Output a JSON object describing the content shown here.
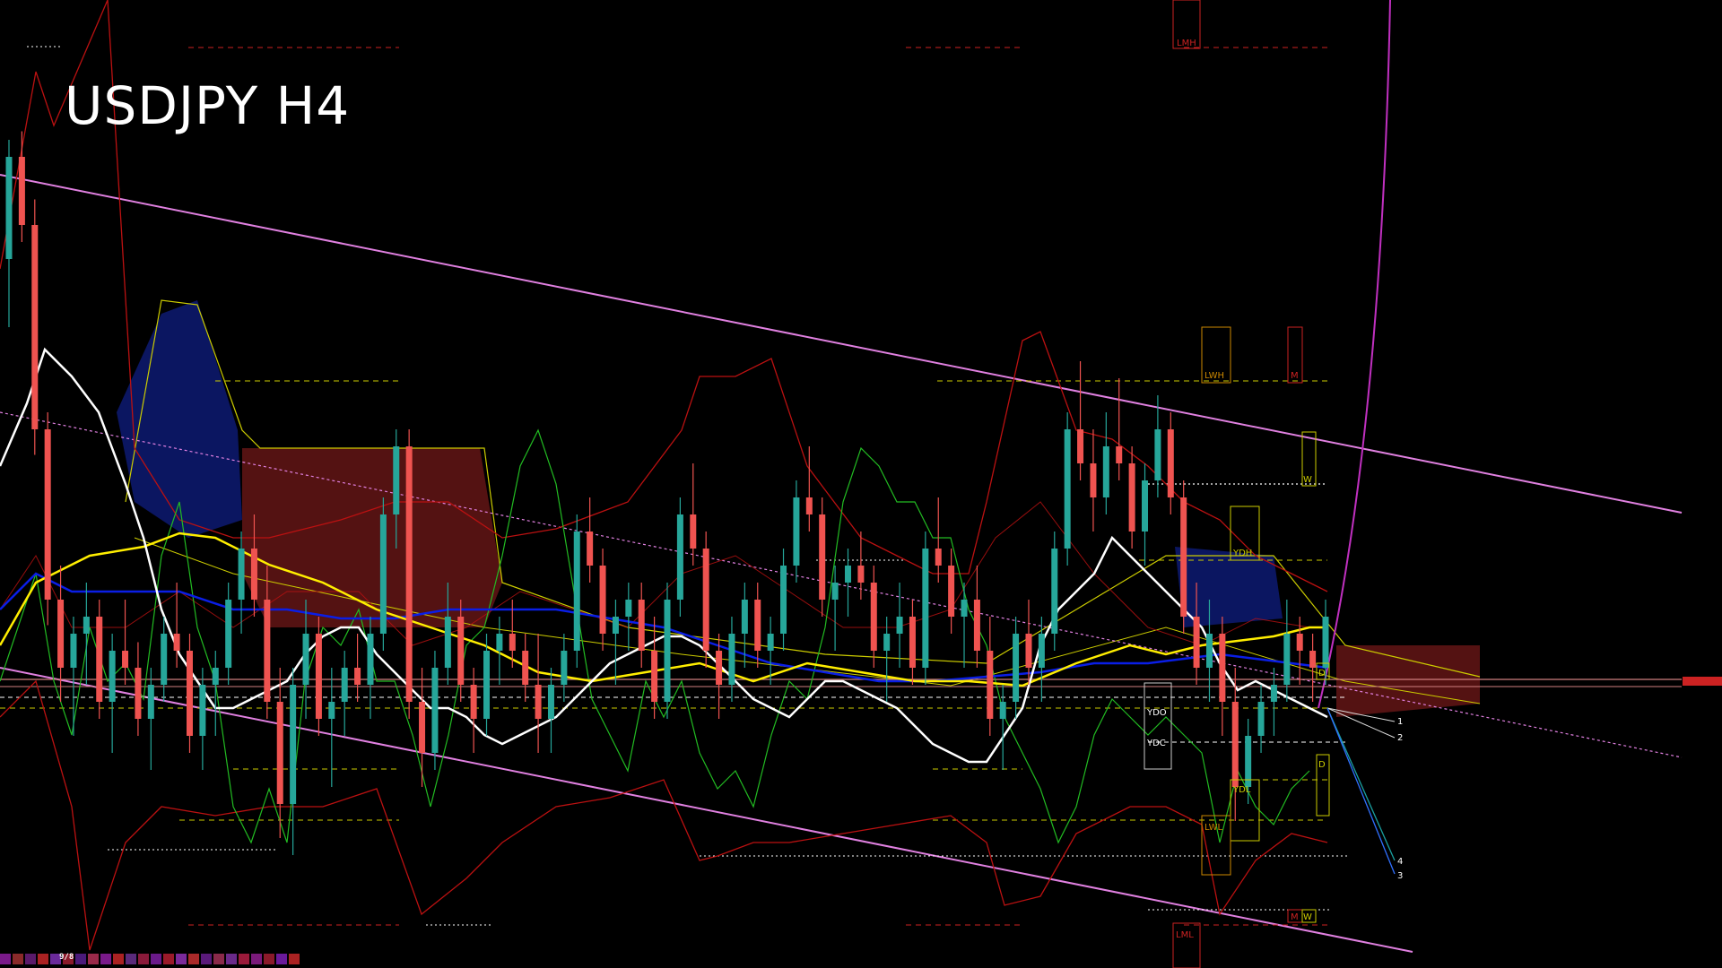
{
  "window": {
    "title": "USDJPY H4",
    "tray_date": "9/8"
  },
  "colors": {
    "background": "#000000",
    "bull_candle": "#26a69a",
    "bear_candle": "#ef5350",
    "ichimoku_bull_cloud": "#1a2a8c",
    "ichimoku_bear_cloud": "#8b1a1a",
    "channel": "#e080e0",
    "ema_white": "#ffffff",
    "ema_yellow": "#ffee00",
    "ema_blue": "#0a1ee6",
    "bollinger": "#cc1111",
    "stoch_green": "#22bb22",
    "level_red": "#cc2222",
    "level_yellow": "#cccc00",
    "level_white": "#ffffff"
  },
  "level_labels": {
    "lmh": "LMH",
    "lml": "LML",
    "lwh": "LWH",
    "lwl": "LWL",
    "m_top": "M",
    "m_bottom": "M",
    "w_top": "W",
    "w_bottom": "W",
    "ydh": "YDH",
    "ydl": "YDL",
    "ydo": "YDO",
    "ydc": "YDC",
    "d_top": "D",
    "d_bottom": "D"
  },
  "projection_labels": [
    "1",
    "2",
    "4",
    "3"
  ],
  "chart_data": {
    "type": "candlestick",
    "title": "USDJPY H4",
    "xlabel": "",
    "ylabel": "",
    "grid": false,
    "candles_ohlc": [
      [
        0.78,
        0.92,
        0.7,
        0.9
      ],
      [
        0.9,
        0.93,
        0.8,
        0.82
      ],
      [
        0.82,
        0.85,
        0.55,
        0.58
      ],
      [
        0.58,
        0.6,
        0.35,
        0.38
      ],
      [
        0.38,
        0.42,
        0.26,
        0.3
      ],
      [
        0.3,
        0.36,
        0.22,
        0.34
      ],
      [
        0.34,
        0.4,
        0.28,
        0.36
      ],
      [
        0.36,
        0.38,
        0.24,
        0.26
      ],
      [
        0.26,
        0.34,
        0.2,
        0.32
      ],
      [
        0.32,
        0.38,
        0.28,
        0.3
      ],
      [
        0.3,
        0.33,
        0.22,
        0.24
      ],
      [
        0.24,
        0.3,
        0.18,
        0.28
      ],
      [
        0.28,
        0.36,
        0.26,
        0.34
      ],
      [
        0.34,
        0.4,
        0.3,
        0.32
      ],
      [
        0.32,
        0.34,
        0.2,
        0.22
      ],
      [
        0.22,
        0.3,
        0.18,
        0.28
      ],
      [
        0.28,
        0.32,
        0.22,
        0.3
      ],
      [
        0.3,
        0.4,
        0.28,
        0.38
      ],
      [
        0.38,
        0.46,
        0.34,
        0.44
      ],
      [
        0.44,
        0.48,
        0.36,
        0.38
      ],
      [
        0.38,
        0.42,
        0.24,
        0.26
      ],
      [
        0.26,
        0.3,
        0.1,
        0.14
      ],
      [
        0.14,
        0.3,
        0.08,
        0.28
      ],
      [
        0.28,
        0.38,
        0.24,
        0.34
      ],
      [
        0.34,
        0.36,
        0.22,
        0.24
      ],
      [
        0.24,
        0.3,
        0.16,
        0.26
      ],
      [
        0.26,
        0.32,
        0.22,
        0.3
      ],
      [
        0.3,
        0.34,
        0.26,
        0.28
      ],
      [
        0.28,
        0.36,
        0.24,
        0.34
      ],
      [
        0.34,
        0.5,
        0.32,
        0.48
      ],
      [
        0.48,
        0.58,
        0.44,
        0.56
      ],
      [
        0.56,
        0.58,
        0.24,
        0.26
      ],
      [
        0.26,
        0.3,
        0.16,
        0.2
      ],
      [
        0.2,
        0.32,
        0.18,
        0.3
      ],
      [
        0.3,
        0.4,
        0.28,
        0.36
      ],
      [
        0.36,
        0.38,
        0.26,
        0.28
      ],
      [
        0.28,
        0.3,
        0.2,
        0.24
      ],
      [
        0.24,
        0.34,
        0.22,
        0.32
      ],
      [
        0.32,
        0.36,
        0.28,
        0.34
      ],
      [
        0.34,
        0.38,
        0.3,
        0.32
      ],
      [
        0.32,
        0.34,
        0.26,
        0.28
      ],
      [
        0.28,
        0.34,
        0.2,
        0.24
      ],
      [
        0.24,
        0.3,
        0.2,
        0.28
      ],
      [
        0.28,
        0.34,
        0.26,
        0.32
      ],
      [
        0.32,
        0.48,
        0.3,
        0.46
      ],
      [
        0.46,
        0.5,
        0.4,
        0.42
      ],
      [
        0.42,
        0.44,
        0.32,
        0.34
      ],
      [
        0.34,
        0.38,
        0.28,
        0.36
      ],
      [
        0.36,
        0.4,
        0.32,
        0.38
      ],
      [
        0.38,
        0.4,
        0.3,
        0.32
      ],
      [
        0.32,
        0.36,
        0.24,
        0.26
      ],
      [
        0.26,
        0.4,
        0.24,
        0.38
      ],
      [
        0.38,
        0.5,
        0.36,
        0.48
      ],
      [
        0.48,
        0.54,
        0.42,
        0.44
      ],
      [
        0.44,
        0.46,
        0.3,
        0.32
      ],
      [
        0.32,
        0.34,
        0.24,
        0.28
      ],
      [
        0.28,
        0.36,
        0.26,
        0.34
      ],
      [
        0.34,
        0.4,
        0.3,
        0.38
      ],
      [
        0.38,
        0.4,
        0.3,
        0.32
      ],
      [
        0.32,
        0.36,
        0.28,
        0.34
      ],
      [
        0.34,
        0.44,
        0.32,
        0.42
      ],
      [
        0.42,
        0.52,
        0.4,
        0.5
      ],
      [
        0.5,
        0.56,
        0.46,
        0.48
      ],
      [
        0.48,
        0.5,
        0.36,
        0.38
      ],
      [
        0.38,
        0.42,
        0.32,
        0.4
      ],
      [
        0.4,
        0.44,
        0.36,
        0.42
      ],
      [
        0.42,
        0.46,
        0.38,
        0.4
      ],
      [
        0.4,
        0.42,
        0.3,
        0.32
      ],
      [
        0.32,
        0.36,
        0.26,
        0.34
      ],
      [
        0.34,
        0.4,
        0.3,
        0.36
      ],
      [
        0.36,
        0.38,
        0.28,
        0.3
      ],
      [
        0.3,
        0.46,
        0.28,
        0.44
      ],
      [
        0.44,
        0.5,
        0.4,
        0.42
      ],
      [
        0.42,
        0.44,
        0.34,
        0.36
      ],
      [
        0.36,
        0.4,
        0.3,
        0.38
      ],
      [
        0.38,
        0.42,
        0.3,
        0.32
      ],
      [
        0.32,
        0.36,
        0.22,
        0.24
      ],
      [
        0.24,
        0.28,
        0.18,
        0.26
      ],
      [
        0.26,
        0.36,
        0.24,
        0.34
      ],
      [
        0.34,
        0.38,
        0.28,
        0.3
      ],
      [
        0.3,
        0.36,
        0.26,
        0.34
      ],
      [
        0.34,
        0.46,
        0.32,
        0.44
      ],
      [
        0.44,
        0.6,
        0.42,
        0.58
      ],
      [
        0.58,
        0.66,
        0.52,
        0.54
      ],
      [
        0.54,
        0.58,
        0.46,
        0.5
      ],
      [
        0.5,
        0.6,
        0.48,
        0.56
      ],
      [
        0.56,
        0.64,
        0.52,
        0.54
      ],
      [
        0.54,
        0.56,
        0.44,
        0.46
      ],
      [
        0.46,
        0.54,
        0.42,
        0.52
      ],
      [
        0.52,
        0.62,
        0.5,
        0.58
      ],
      [
        0.58,
        0.6,
        0.48,
        0.5
      ],
      [
        0.5,
        0.52,
        0.34,
        0.36
      ],
      [
        0.36,
        0.4,
        0.28,
        0.3
      ],
      [
        0.3,
        0.38,
        0.26,
        0.34
      ],
      [
        0.34,
        0.36,
        0.22,
        0.26
      ],
      [
        0.26,
        0.3,
        0.12,
        0.16
      ],
      [
        0.16,
        0.24,
        0.14,
        0.22
      ],
      [
        0.22,
        0.28,
        0.2,
        0.26
      ],
      [
        0.26,
        0.3,
        0.22,
        0.28
      ],
      [
        0.28,
        0.38,
        0.26,
        0.34
      ],
      [
        0.34,
        0.36,
        0.28,
        0.32
      ],
      [
        0.32,
        0.34,
        0.26,
        0.3
      ],
      [
        0.3,
        0.38,
        0.28,
        0.36
      ]
    ],
    "price_range": [
      0,
      1
    ]
  }
}
